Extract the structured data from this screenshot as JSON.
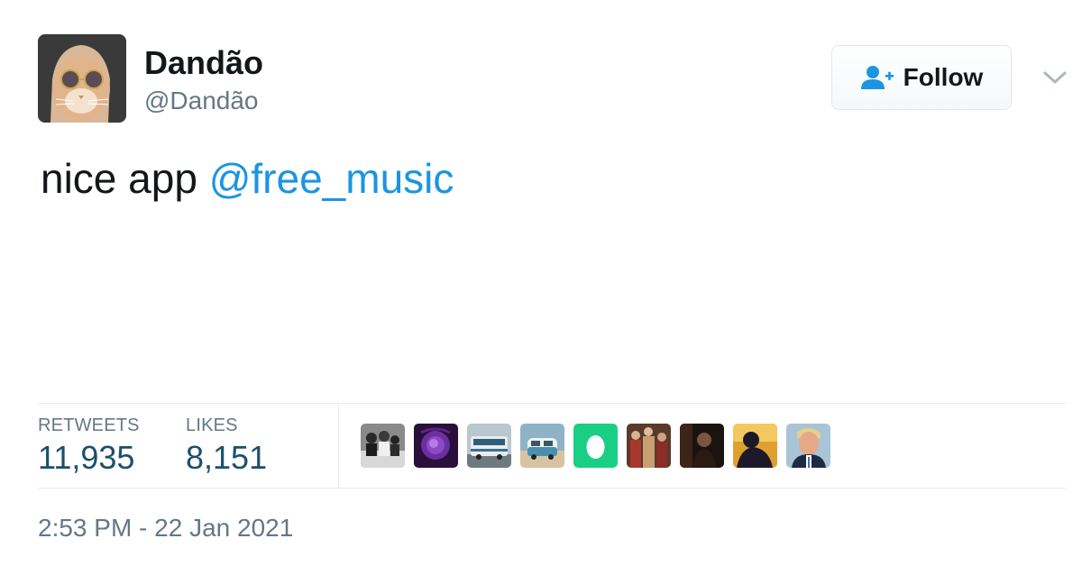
{
  "user": {
    "display_name": "Dandão",
    "handle": "@Dandão"
  },
  "follow_button": {
    "label": "Follow"
  },
  "tweet": {
    "text": "nice app ",
    "mention": "@free_music"
  },
  "stats": {
    "retweets_label": "RETWEETS",
    "retweets_value": "11,935",
    "likes_label": "LIKES",
    "likes_value": "8,151"
  },
  "liked_by_avatars": [
    {
      "kind": "group-photo-bw"
    },
    {
      "kind": "purple-flower"
    },
    {
      "kind": "bus-photo"
    },
    {
      "kind": "van-photo"
    },
    {
      "kind": "default-egg"
    },
    {
      "kind": "people-photo"
    },
    {
      "kind": "dark-portrait"
    },
    {
      "kind": "silhouette-sunset"
    },
    {
      "kind": "man-portrait"
    }
  ],
  "timestamp": "2:53 PM - 22 Jan 2021",
  "colors": {
    "link": "#1b95e0",
    "stat_value": "#1c4f6d",
    "muted": "#657786",
    "egg_green": "#19cf86"
  }
}
